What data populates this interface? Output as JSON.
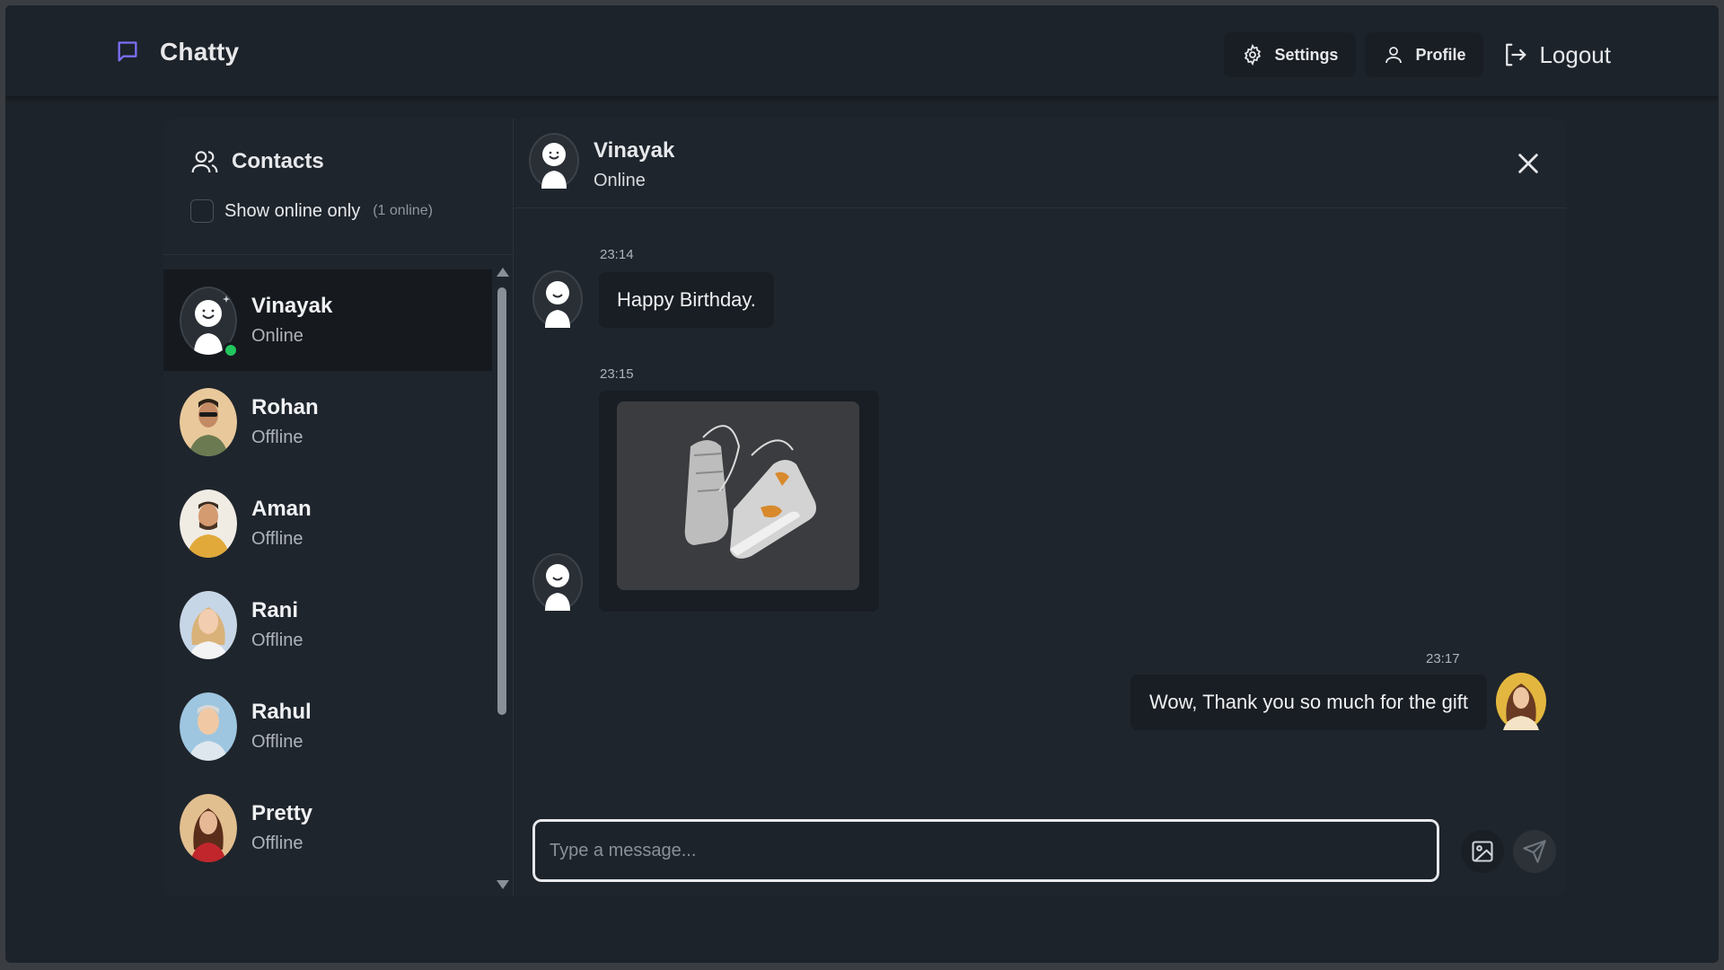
{
  "brand": {
    "name": "Chatty",
    "icon": "message-square-icon"
  },
  "nav": {
    "settings_label": "Settings",
    "profile_label": "Profile",
    "logout_label": "Logout"
  },
  "sidebar": {
    "title": "Contacts",
    "filter_label": "Show online only",
    "online_count": "(1 online)",
    "contacts": [
      {
        "name": "Vinayak",
        "status": "Online",
        "active": true,
        "avatar": "default-avatar-icon"
      },
      {
        "name": "Rohan",
        "status": "Offline",
        "active": false,
        "avatar": "photo"
      },
      {
        "name": "Aman",
        "status": "Offline",
        "active": false,
        "avatar": "photo"
      },
      {
        "name": "Rani",
        "status": "Offline",
        "active": false,
        "avatar": "photo"
      },
      {
        "name": "Rahul",
        "status": "Offline",
        "active": false,
        "avatar": "photo"
      },
      {
        "name": "Pretty",
        "status": "Offline",
        "active": false,
        "avatar": "photo"
      }
    ]
  },
  "chat": {
    "name": "Vinayak",
    "status": "Online",
    "messages": [
      {
        "time": "23:14",
        "text": "Happy Birthday.",
        "from": "contact"
      },
      {
        "time": "23:15",
        "image": "sneakers-photo",
        "from": "contact"
      },
      {
        "time": "23:17",
        "text": "Wow, Thank you so much for the gift",
        "from": "me"
      }
    ],
    "input_placeholder": "Type a message..."
  },
  "colors": {
    "accent": "#6d5dfc",
    "online": "#22c55e",
    "background": "#1d232a"
  }
}
